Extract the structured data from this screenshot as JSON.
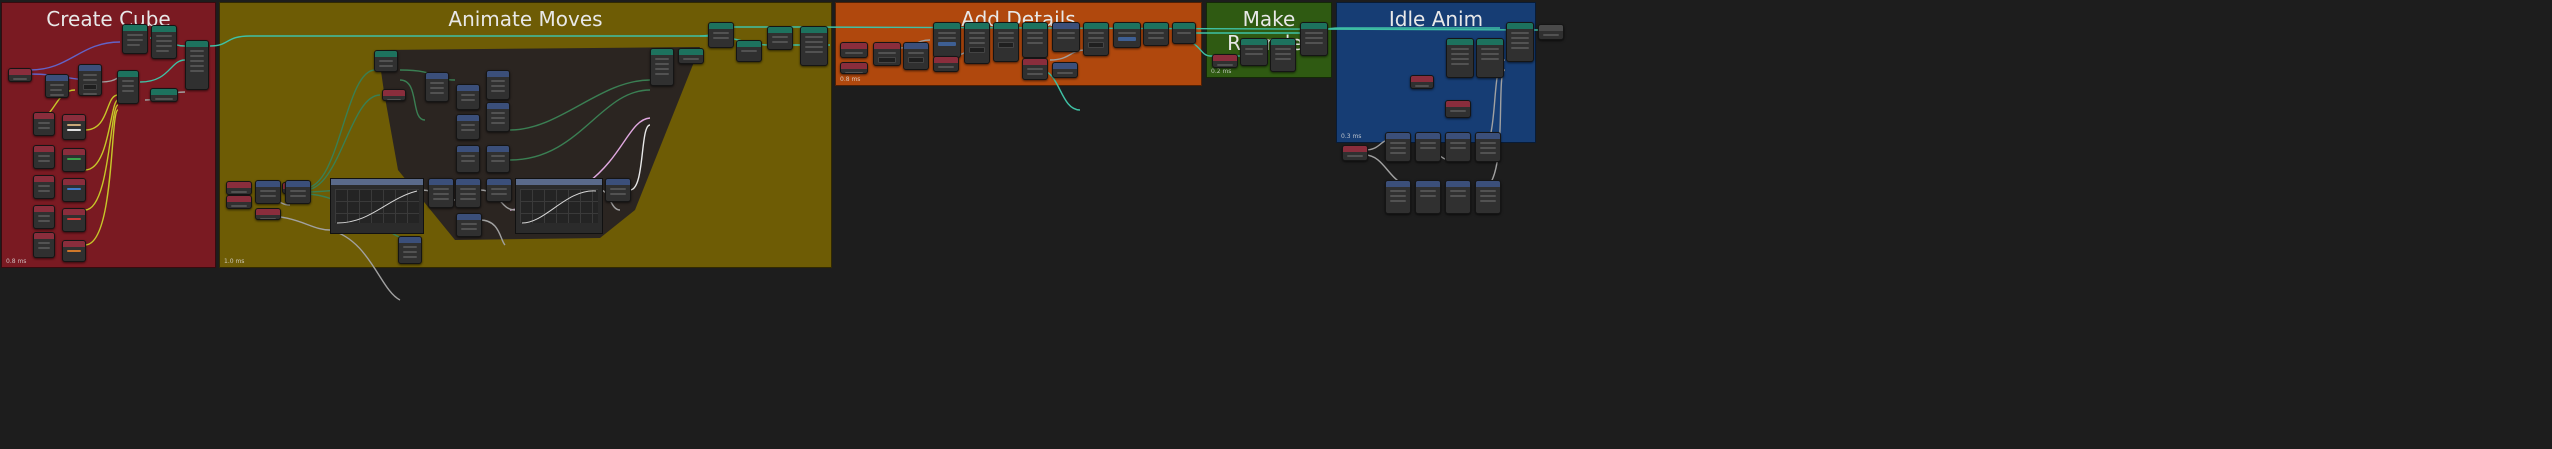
{
  "editor": "Geometry Node Editor",
  "frames": [
    {
      "id": "create-cube",
      "title": "Create Cube",
      "color": "#7a1a22",
      "footer": "0.8 ms"
    },
    {
      "id": "animate-moves",
      "title": "Animate Moves",
      "color": "#6e5c05",
      "footer": "1.0 ms"
    },
    {
      "id": "add-details",
      "title": "Add Details",
      "color": "#b0480d",
      "footer": "0.8 ms"
    },
    {
      "id": "make-rounder",
      "title": "Make Rounder",
      "color": "#2f5a12",
      "footer": "0.2 ms"
    },
    {
      "id": "idle-anim",
      "title": "Idle Anim",
      "color": "#163d74",
      "footer": "0.3 ms"
    }
  ],
  "colors": {
    "background": "#1d1d1d",
    "node_body": "#303030",
    "geometry_header": "#1d725e",
    "input_header": "#8a2d3c",
    "utility_header": "#3b4f7a",
    "wire_geometry": "#3fc1a5",
    "wire_float": "#a1a1a1",
    "wire_vector": "#6363c7",
    "wire_color": "#c7c729",
    "wire_int": "#3a7f53"
  }
}
